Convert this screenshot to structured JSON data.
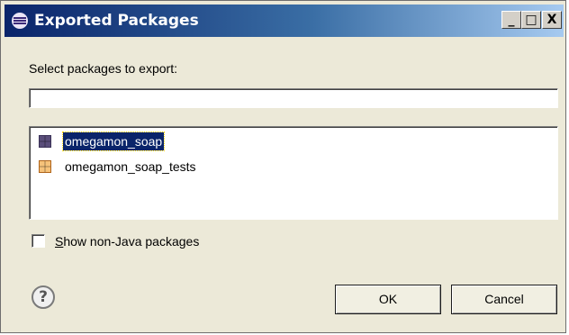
{
  "window": {
    "title": "Exported Packages",
    "minimize_glyph": "_",
    "maximize_glyph": "□",
    "close_glyph": "X"
  },
  "dialog": {
    "prompt": "Select packages to export:",
    "filter": {
      "value": "",
      "placeholder": ""
    },
    "packages": [
      {
        "label": "omegamon_soap",
        "selected": true,
        "icon": "package-icon",
        "icon_color": "#5a4e7a"
      },
      {
        "label": "omegamon_soap_tests",
        "selected": false,
        "icon": "package-icon",
        "icon_color": "#d08a2a"
      }
    ],
    "show_non_java": {
      "checked": false,
      "mnemonic": "S",
      "label_rest": "how non-Java packages"
    },
    "help_glyph": "?",
    "ok_label": "OK",
    "cancel_label": "Cancel"
  }
}
